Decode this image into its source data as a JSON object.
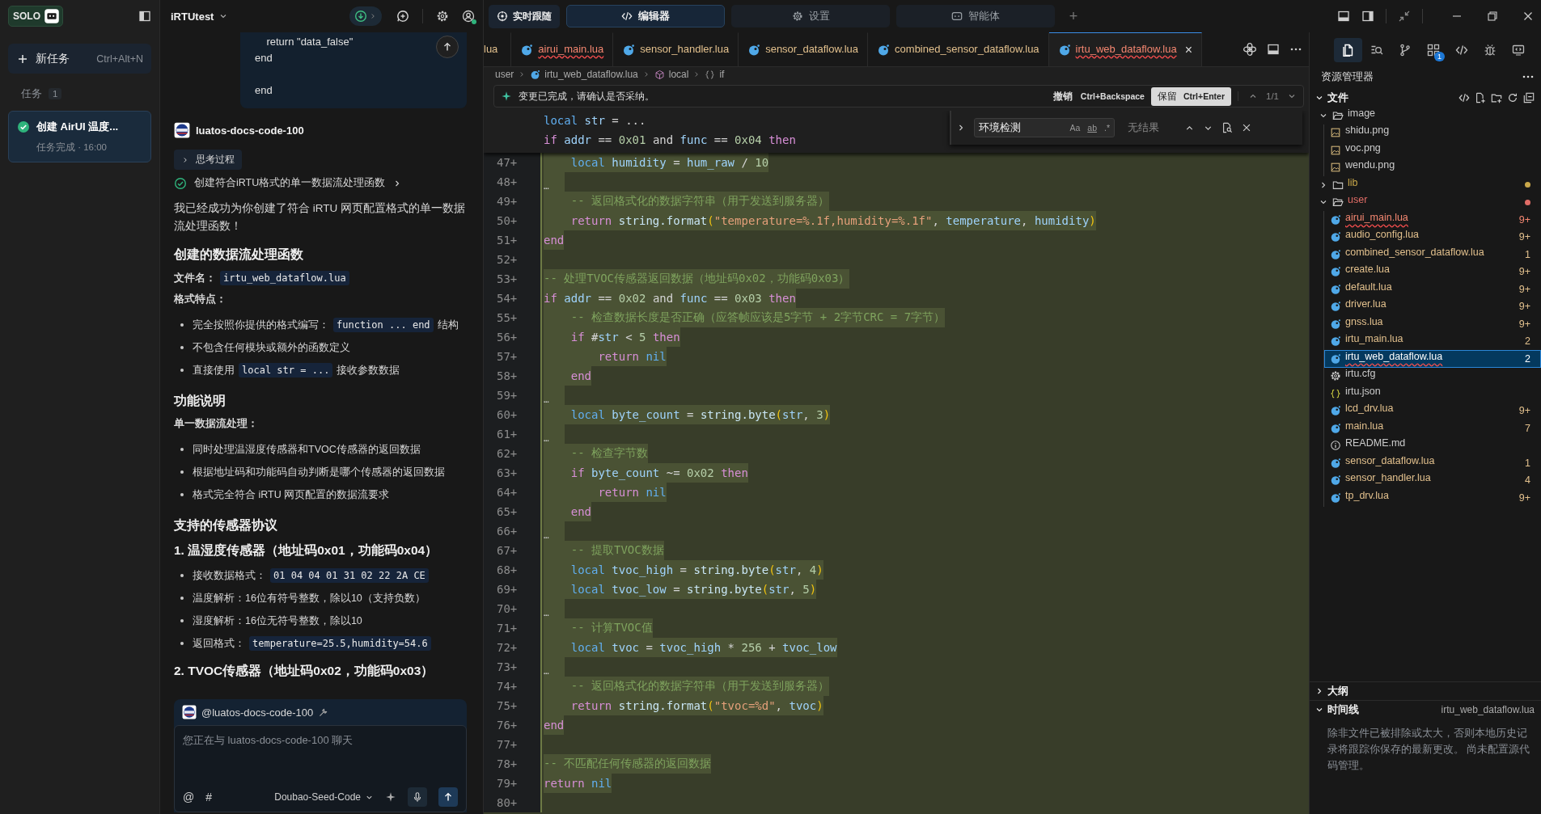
{
  "sidebar": {
    "logo": "SOLO",
    "new_task": {
      "label": "新任务",
      "shortcut": "Ctrl+Alt+N"
    },
    "tasks_heading": {
      "label": "任务",
      "count": "1"
    },
    "tasks": [
      {
        "title": "创建 AirUI 温度...",
        "status": "任务完成 · 16:00",
        "done": true,
        "selected": true
      }
    ]
  },
  "chat": {
    "project": "iRTUtest",
    "code_fragment": [
      {
        "kind": "code",
        "text": "    return \"data_false\""
      },
      {
        "kind": "code",
        "text": "end"
      },
      {
        "kind": "blank"
      },
      {
        "kind": "code",
        "text": "end"
      }
    ],
    "agent": "luatos-docs-code-100",
    "thinking": "思考过程",
    "step": {
      "label": "创建符合iRTU格式的单一数据流处理函数",
      "done": true
    },
    "blocks": [
      {
        "kind": "para",
        "parts": [
          {
            "kind": "text",
            "text": "我已经成功为你创建了符合 iRTU 网页配置格式的单一数据流处理函数！"
          }
        ]
      },
      {
        "kind": "h2",
        "parts": [
          {
            "kind": "text",
            "text": "创建的数据流处理函数"
          }
        ]
      },
      {
        "kind": "label",
        "parts": [
          {
            "kind": "text",
            "text": "文件名："
          },
          {
            "kind": "code",
            "text": "irtu_web_dataflow.lua"
          }
        ]
      },
      {
        "kind": "label",
        "parts": [
          {
            "kind": "text",
            "text": "格式特点："
          }
        ]
      },
      {
        "kind": "bullet",
        "parts": [
          {
            "kind": "text",
            "text": "完全按照你提供的格式编写："
          },
          {
            "kind": "code",
            "text": "function ... end"
          },
          {
            "kind": "text",
            "text": "结构"
          }
        ]
      },
      {
        "kind": "bullet",
        "parts": [
          {
            "kind": "text",
            "text": "不包含任何模块或额外的函数定义"
          }
        ]
      },
      {
        "kind": "bullet",
        "parts": [
          {
            "kind": "text",
            "text": "直接使用"
          },
          {
            "kind": "code",
            "text": "local str = ..."
          },
          {
            "kind": "text",
            "text": "接收参数数据"
          }
        ]
      },
      {
        "kind": "h2",
        "parts": [
          {
            "kind": "text",
            "text": "功能说明"
          }
        ]
      },
      {
        "kind": "label",
        "parts": [
          {
            "kind": "text",
            "text": "单一数据流处理："
          }
        ]
      },
      {
        "kind": "bullet",
        "parts": [
          {
            "kind": "text",
            "text": "同时处理温湿度传感器和TVOC传感器的返回数据"
          }
        ]
      },
      {
        "kind": "bullet",
        "parts": [
          {
            "kind": "text",
            "text": "根据地址码和功能码自动判断是哪个传感器的返回数据"
          }
        ]
      },
      {
        "kind": "bullet",
        "parts": [
          {
            "kind": "text",
            "text": "格式完全符合 iRTU 网页配置的数据流要求"
          }
        ]
      },
      {
        "kind": "h2",
        "parts": [
          {
            "kind": "text",
            "text": "支持的传感器协议"
          }
        ]
      },
      {
        "kind": "h3",
        "parts": [
          {
            "kind": "text",
            "text": "1. 温湿度传感器（地址码0x01，功能码0x04）"
          }
        ]
      },
      {
        "kind": "bullet",
        "parts": [
          {
            "kind": "text",
            "text": "接收数据格式："
          },
          {
            "kind": "code",
            "text": "01 04 04 01 31 02 22 2A CE"
          }
        ]
      },
      {
        "kind": "bullet",
        "parts": [
          {
            "kind": "text",
            "text": "温度解析：16位有符号整数，除以10（支持负数）"
          }
        ]
      },
      {
        "kind": "bullet",
        "parts": [
          {
            "kind": "text",
            "text": "湿度解析：16位无符号整数，除以10"
          }
        ]
      },
      {
        "kind": "bullet",
        "parts": [
          {
            "kind": "text",
            "text": "返回格式："
          },
          {
            "kind": "code",
            "text": "temperature=25.5,humidity=54.6"
          }
        ]
      },
      {
        "kind": "h3",
        "parts": [
          {
            "kind": "text",
            "text": "2. TVOC传感器（地址码0x02，功能码0x03）"
          }
        ]
      }
    ],
    "composer": {
      "mention": "@luatos-docs-code-100",
      "placeholder": "您正在与 luatos-docs-code-100 聊天",
      "at": "@",
      "hash": "#",
      "model": "Doubao-Seed-Code"
    }
  },
  "top_bar": {
    "follow": "实时跟随",
    "view_tabs": [
      {
        "label": "编辑器",
        "selected": true
      },
      {
        "label": "设置",
        "selected": false
      },
      {
        "label": "智能体",
        "selected": false
      }
    ],
    "add": "+"
  },
  "editor": {
    "file_tabs": [
      {
        "label": "lua",
        "kind": "partial",
        "color": "#e2c08d",
        "error": false,
        "selected": false
      },
      {
        "label": "airui_main.lua",
        "kind": "file",
        "color": "#f48771",
        "error": true,
        "selected": false
      },
      {
        "label": "sensor_handler.lua",
        "kind": "file",
        "color": "#e2c08d",
        "error": false,
        "selected": false
      },
      {
        "label": "sensor_dataflow.lua",
        "kind": "file",
        "color": "#e2c08d",
        "error": false,
        "selected": false
      },
      {
        "label": "combined_sensor_dataflow.lua",
        "kind": "file",
        "color": "#e2c08d",
        "error": false,
        "selected": false
      },
      {
        "label": "irtu_web_dataflow.lua",
        "kind": "file",
        "color": "#f48771",
        "error": true,
        "selected": true,
        "close": "×"
      }
    ],
    "breadcrumb": [
      {
        "text": "user",
        "kind": "folder"
      },
      {
        "text": "irtu_web_dataflow.lua",
        "kind": "lua"
      },
      {
        "text": "local",
        "kind": "symbol"
      },
      {
        "text": "if",
        "kind": "braces"
      }
    ],
    "diff_bar": {
      "message": "变更已完成，请确认是否采纳。",
      "reject": {
        "label": "撤销",
        "shortcut": "Ctrl+Backspace"
      },
      "accept": {
        "label": "保留",
        "shortcut": "Ctrl+Enter"
      },
      "counter": "1/1"
    },
    "find": {
      "value": "环境检测",
      "options": [
        "Aa",
        "ab",
        ".*"
      ],
      "result": "无结果"
    },
    "sticky": [
      [
        {
          "kind": "kw",
          "text": "local"
        },
        {
          "kind": "var",
          "text": " str"
        },
        {
          "kind": "op",
          "text": " = ..."
        }
      ],
      [
        {
          "kind": "ctl",
          "text": "if"
        },
        {
          "kind": "var",
          "text": " addr"
        },
        {
          "kind": "op",
          "text": " == "
        },
        {
          "kind": "num",
          "text": "0x01"
        },
        {
          "kind": "op",
          "text": " and "
        },
        {
          "kind": "var",
          "text": "func"
        },
        {
          "kind": "op",
          "text": " == "
        },
        {
          "kind": "num",
          "text": "0x04"
        },
        {
          "kind": "ctl",
          "text": " then"
        }
      ]
    ],
    "lines": [
      {
        "number": "47+",
        "added": true,
        "tokens": [
          {
            "kind": "kw",
            "text": "    local"
          },
          {
            "kind": "var",
            "text": " humidity"
          },
          {
            "kind": "op",
            "text": " = "
          },
          {
            "kind": "var",
            "text": "hum_raw"
          },
          {
            "kind": "op",
            "text": " / "
          },
          {
            "kind": "num",
            "text": "10"
          }
        ]
      },
      {
        "number": "48+",
        "added": true,
        "marker": "…"
      },
      {
        "number": "49+",
        "added": true,
        "tokens": [
          {
            "kind": "cmt",
            "text": "    -- 返回格式化的数据字符串（用于发送到服务器）"
          }
        ]
      },
      {
        "number": "50+",
        "added": true,
        "tokens": [
          {
            "kind": "ctl",
            "text": "    return"
          },
          {
            "kind": "fn",
            "text": " string.format"
          },
          {
            "kind": "br",
            "text": "("
          },
          {
            "kind": "str",
            "text": "\"temperature=%.1f,humidity=%.1f\""
          },
          {
            "kind": "op",
            "text": ", "
          },
          {
            "kind": "var",
            "text": "temperature"
          },
          {
            "kind": "op",
            "text": ", "
          },
          {
            "kind": "var",
            "text": "humidity"
          },
          {
            "kind": "br",
            "text": ")"
          }
        ]
      },
      {
        "number": "51+",
        "added": true,
        "tokens": [
          {
            "kind": "ctl",
            "text": "end"
          }
        ]
      },
      {
        "number": "52+",
        "added": true
      },
      {
        "number": "53+",
        "added": true,
        "tokens": [
          {
            "kind": "cmt",
            "text": "-- 处理TVOC传感器返回数据（地址码0x02，功能码0x03）"
          }
        ]
      },
      {
        "number": "54+",
        "added": true,
        "tokens": [
          {
            "kind": "ctl",
            "text": "if"
          },
          {
            "kind": "var",
            "text": " addr"
          },
          {
            "kind": "op",
            "text": " == "
          },
          {
            "kind": "num",
            "text": "0x02"
          },
          {
            "kind": "op",
            "text": " and "
          },
          {
            "kind": "var",
            "text": "func"
          },
          {
            "kind": "op",
            "text": " == "
          },
          {
            "kind": "num",
            "text": "0x03"
          },
          {
            "kind": "ctl",
            "text": " then"
          }
        ]
      },
      {
        "number": "55+",
        "added": true,
        "tokens": [
          {
            "kind": "cmt",
            "text": "    -- 检查数据长度是否正确（应答帧应该是5字节 + 2字节CRC = 7字节）"
          }
        ]
      },
      {
        "number": "56+",
        "added": true,
        "tokens": [
          {
            "kind": "ctl",
            "text": "    if"
          },
          {
            "kind": "op",
            "text": " #"
          },
          {
            "kind": "var",
            "text": "str"
          },
          {
            "kind": "op",
            "text": " < "
          },
          {
            "kind": "num",
            "text": "5"
          },
          {
            "kind": "ctl",
            "text": " then"
          }
        ]
      },
      {
        "number": "57+",
        "added": true,
        "tokens": [
          {
            "kind": "ctl",
            "text": "        return"
          },
          {
            "kind": "kw",
            "text": " nil"
          }
        ]
      },
      {
        "number": "58+",
        "added": true,
        "tokens": [
          {
            "kind": "ctl",
            "text": "    end"
          }
        ]
      },
      {
        "number": "59+",
        "added": true,
        "marker": "…"
      },
      {
        "number": "60+",
        "added": true,
        "tokens": [
          {
            "kind": "kw",
            "text": "    local"
          },
          {
            "kind": "var",
            "text": " byte_count"
          },
          {
            "kind": "op",
            "text": " = "
          },
          {
            "kind": "fn",
            "text": "string.byte"
          },
          {
            "kind": "br",
            "text": "("
          },
          {
            "kind": "var",
            "text": "str"
          },
          {
            "kind": "op",
            "text": ", "
          },
          {
            "kind": "num",
            "text": "3"
          },
          {
            "kind": "br",
            "text": ")"
          }
        ]
      },
      {
        "number": "61+",
        "added": true,
        "marker": "…"
      },
      {
        "number": "62+",
        "added": true,
        "tokens": [
          {
            "kind": "cmt",
            "text": "    -- 检查字节数"
          }
        ]
      },
      {
        "number": "63+",
        "added": true,
        "tokens": [
          {
            "kind": "ctl",
            "text": "    if"
          },
          {
            "kind": "var",
            "text": " byte_count"
          },
          {
            "kind": "op",
            "text": " ~= "
          },
          {
            "kind": "num",
            "text": "0x02"
          },
          {
            "kind": "ctl",
            "text": " then"
          }
        ]
      },
      {
        "number": "64+",
        "added": true,
        "tokens": [
          {
            "kind": "ctl",
            "text": "        return"
          },
          {
            "kind": "kw",
            "text": " nil"
          }
        ]
      },
      {
        "number": "65+",
        "added": true,
        "tokens": [
          {
            "kind": "ctl",
            "text": "    end"
          }
        ]
      },
      {
        "number": "66+",
        "added": true,
        "marker": "…"
      },
      {
        "number": "67+",
        "added": true,
        "tokens": [
          {
            "kind": "cmt",
            "text": "    -- 提取TVOC数据"
          }
        ]
      },
      {
        "number": "68+",
        "added": true,
        "tokens": [
          {
            "kind": "kw",
            "text": "    local"
          },
          {
            "kind": "var",
            "text": " tvoc_high"
          },
          {
            "kind": "op",
            "text": " = "
          },
          {
            "kind": "fn",
            "text": "string.byte"
          },
          {
            "kind": "br",
            "text": "("
          },
          {
            "kind": "var",
            "text": "str"
          },
          {
            "kind": "op",
            "text": ", "
          },
          {
            "kind": "num",
            "text": "4"
          },
          {
            "kind": "br",
            "text": ")"
          }
        ]
      },
      {
        "number": "69+",
        "added": true,
        "tokens": [
          {
            "kind": "kw",
            "text": "    local"
          },
          {
            "kind": "var",
            "text": " tvoc_low"
          },
          {
            "kind": "op",
            "text": " = "
          },
          {
            "kind": "fn",
            "text": "string.byte"
          },
          {
            "kind": "br",
            "text": "("
          },
          {
            "kind": "var",
            "text": "str"
          },
          {
            "kind": "op",
            "text": ", "
          },
          {
            "kind": "num",
            "text": "5"
          },
          {
            "kind": "br",
            "text": ")"
          }
        ]
      },
      {
        "number": "70+",
        "added": true,
        "marker": "…"
      },
      {
        "number": "71+",
        "added": true,
        "tokens": [
          {
            "kind": "cmt",
            "text": "    -- 计算TVOC值"
          }
        ]
      },
      {
        "number": "72+",
        "added": true,
        "tokens": [
          {
            "kind": "kw",
            "text": "    local"
          },
          {
            "kind": "var",
            "text": " tvoc"
          },
          {
            "kind": "op",
            "text": " = "
          },
          {
            "kind": "var",
            "text": "tvoc_high"
          },
          {
            "kind": "op",
            "text": " * "
          },
          {
            "kind": "num",
            "text": "256"
          },
          {
            "kind": "op",
            "text": " + "
          },
          {
            "kind": "var",
            "text": "tvoc_low"
          }
        ]
      },
      {
        "number": "73+",
        "added": true,
        "marker": "…"
      },
      {
        "number": "74+",
        "added": true,
        "tokens": [
          {
            "kind": "cmt",
            "text": "    -- 返回格式化的数据字符串（用于发送到服务器）"
          }
        ]
      },
      {
        "number": "75+",
        "added": true,
        "tokens": [
          {
            "kind": "ctl",
            "text": "    return"
          },
          {
            "kind": "fn",
            "text": " string.format"
          },
          {
            "kind": "br",
            "text": "("
          },
          {
            "kind": "str",
            "text": "\"tvoc=%d\""
          },
          {
            "kind": "op",
            "text": ", "
          },
          {
            "kind": "var",
            "text": "tvoc"
          },
          {
            "kind": "br",
            "text": ")"
          }
        ]
      },
      {
        "number": "76+",
        "added": true,
        "tokens": [
          {
            "kind": "ctl",
            "text": "end"
          }
        ]
      },
      {
        "number": "77+",
        "added": true
      },
      {
        "number": "78+",
        "added": true,
        "tokens": [
          {
            "kind": "cmt",
            "text": "-- 不匹配任何传感器的返回数据"
          }
        ]
      },
      {
        "number": "79+",
        "added": true,
        "tokens": [
          {
            "kind": "ctl",
            "text": "return"
          },
          {
            "kind": "kw",
            "text": " nil"
          }
        ]
      },
      {
        "number": "80+",
        "added": true
      }
    ]
  },
  "explorer": {
    "activity": [
      {
        "selected": true
      },
      {
        "selected": false
      },
      {
        "selected": false
      },
      {
        "selected": false,
        "badge": "1"
      },
      {
        "selected": false
      },
      {
        "selected": false
      },
      {
        "selected": false
      }
    ],
    "title": "资源管理器",
    "section": "文件",
    "tree": [
      {
        "name": "image",
        "kind": "folder",
        "expanded": true,
        "color": "#cccccc",
        "children": [
          {
            "name": "shidu.png",
            "kind": "image",
            "color": "#cccccc"
          },
          {
            "name": "voc.png",
            "kind": "image",
            "color": "#cccccc"
          },
          {
            "name": "wendu.png",
            "kind": "image",
            "color": "#cccccc"
          }
        ]
      },
      {
        "name": "lib",
        "kind": "folder",
        "expanded": false,
        "color": "#c9a84a",
        "dot": true
      },
      {
        "name": "user",
        "kind": "folder",
        "expanded": true,
        "color": "#e06c66",
        "dot": true,
        "children": [
          {
            "name": "airui_main.lua",
            "kind": "lua",
            "color": "#f48771",
            "badge": "9+",
            "error": true,
            "selected": false
          },
          {
            "name": "audio_config.lua",
            "kind": "lua",
            "color": "#e2c08d",
            "badge": "9+",
            "error": false,
            "selected": false
          },
          {
            "name": "combined_sensor_dataflow.lua",
            "kind": "lua",
            "color": "#e2c08d",
            "badge": "1",
            "error": false,
            "selected": false
          },
          {
            "name": "create.lua",
            "kind": "lua",
            "color": "#e2c08d",
            "badge": "9+",
            "error": false,
            "selected": false
          },
          {
            "name": "default.lua",
            "kind": "lua",
            "color": "#e2c08d",
            "badge": "9+",
            "error": false,
            "selected": false
          },
          {
            "name": "driver.lua",
            "kind": "lua",
            "color": "#e2c08d",
            "badge": "9+",
            "error": false,
            "selected": false
          },
          {
            "name": "gnss.lua",
            "kind": "lua",
            "color": "#e2c08d",
            "badge": "9+",
            "error": false,
            "selected": false
          },
          {
            "name": "irtu_main.lua",
            "kind": "lua",
            "color": "#e2c08d",
            "badge": "2",
            "error": false,
            "selected": false
          },
          {
            "name": "irtu_web_dataflow.lua",
            "kind": "lua",
            "color": "#ffffff",
            "badge": "2",
            "error": true,
            "selected": true
          },
          {
            "name": "irtu.cfg",
            "kind": "gear",
            "color": "#cccccc",
            "error": false,
            "selected": false
          },
          {
            "name": "irtu.json",
            "kind": "json",
            "color": "#cccccc",
            "error": false,
            "selected": false
          },
          {
            "name": "lcd_drv.lua",
            "kind": "lua",
            "color": "#e2c08d",
            "badge": "9+",
            "error": false,
            "selected": false
          },
          {
            "name": "main.lua",
            "kind": "lua",
            "color": "#e2c08d",
            "badge": "7",
            "error": false,
            "selected": false
          },
          {
            "name": "README.md",
            "kind": "info",
            "color": "#cccccc",
            "error": false,
            "selected": false
          },
          {
            "name": "sensor_dataflow.lua",
            "kind": "lua",
            "color": "#e2c08d",
            "badge": "1",
            "error": false,
            "selected": false
          },
          {
            "name": "sensor_handler.lua",
            "kind": "lua",
            "color": "#e2c08d",
            "badge": "4",
            "error": false,
            "selected": false
          },
          {
            "name": "tp_drv.lua",
            "kind": "lua",
            "color": "#e2c08d",
            "badge": "9+",
            "error": false,
            "selected": false
          }
        ]
      }
    ],
    "outline": {
      "label": "大纲",
      "expanded": false
    },
    "timeline": {
      "label": "时间线",
      "expanded": true,
      "file": "irtu_web_dataflow.lua",
      "message": "除非文件已被排除或太大，否则本地历史记录将跟踪你保存的最新更改。 尚未配置源代码管理。"
    }
  }
}
